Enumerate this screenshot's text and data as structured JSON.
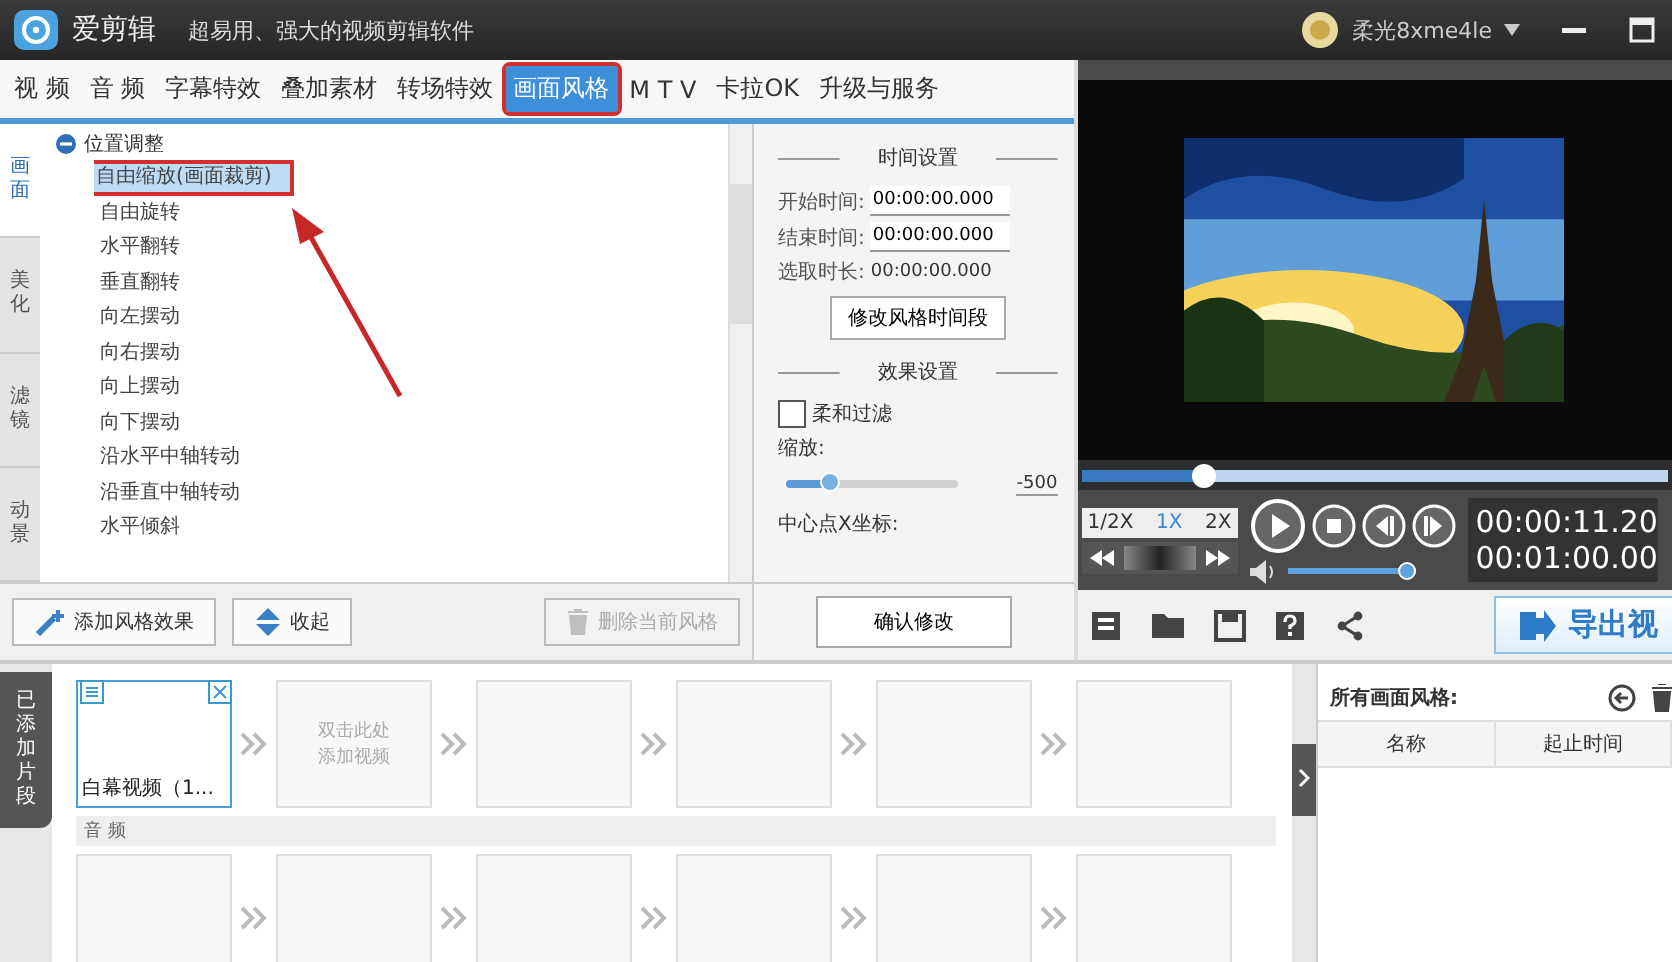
{
  "app": {
    "name": "爱剪辑",
    "slogan": "超易用、强大的视频剪辑软件",
    "user": "柔光8xme4le"
  },
  "tabs": [
    {
      "label": "视 频",
      "selected": false
    },
    {
      "label": "音 频",
      "selected": false
    },
    {
      "label": "字幕特效",
      "selected": false
    },
    {
      "label": "叠加素材",
      "selected": false
    },
    {
      "label": "转场特效",
      "selected": false
    },
    {
      "label": "画面风格",
      "selected": true
    },
    {
      "label": "M T V",
      "selected": false
    },
    {
      "label": "卡拉OK",
      "selected": false
    },
    {
      "label": "升级与服务",
      "selected": false
    }
  ],
  "side_tabs": [
    {
      "label": "画面",
      "selected": true
    },
    {
      "label": "美化",
      "selected": false
    },
    {
      "label": "滤镜",
      "selected": false
    },
    {
      "label": "动景",
      "selected": false
    }
  ],
  "effect_tree": {
    "group": "位置调整",
    "expanded": true,
    "items": [
      {
        "label": "自由缩放(画面裁剪)",
        "selected": true
      },
      {
        "label": "自由旋转",
        "selected": false
      },
      {
        "label": "水平翻转",
        "selected": false
      },
      {
        "label": "垂直翻转",
        "selected": false
      },
      {
        "label": "向左摆动",
        "selected": false
      },
      {
        "label": "向右摆动",
        "selected": false
      },
      {
        "label": "向上摆动",
        "selected": false
      },
      {
        "label": "向下摆动",
        "selected": false
      },
      {
        "label": "沿水平中轴转动",
        "selected": false
      },
      {
        "label": "沿垂直中轴转动",
        "selected": false
      },
      {
        "label": "水平倾斜",
        "selected": false
      }
    ]
  },
  "panel_buttons": [
    {
      "label": "添加风格效果",
      "kind": "add",
      "disabled": false
    },
    {
      "label": "收起",
      "kind": "collapse",
      "disabled": false
    },
    {
      "label": "删除当前风格",
      "kind": "delete",
      "disabled": true
    }
  ],
  "time_settings": {
    "heading": "时间设置",
    "fields": [
      {
        "label": "开始时间:",
        "value": "00:00:00.000",
        "kind": "input"
      },
      {
        "label": "结束时间:",
        "value": "00:00:00.000",
        "kind": "input"
      },
      {
        "label": "选取时长:",
        "value": "00:00:00.000",
        "kind": "text"
      }
    ],
    "button": "修改风格时间段"
  },
  "effect_settings": {
    "heading": "效果设置",
    "soft_filter": {
      "label": "柔和过滤",
      "checked": false
    },
    "zoom": {
      "label": "缩放:",
      "level": 0.25,
      "value": "-500"
    },
    "center_label": "中心点X坐标:"
  },
  "confirm_button": "确认修改",
  "player": {
    "progress": {
      "level": 0.21
    },
    "speeds": [
      {
        "label": "1/2X",
        "selected": false
      },
      {
        "label": "1X",
        "selected": true
      },
      {
        "label": "2X",
        "selected": false
      }
    ],
    "volume": {
      "level": 1.0
    },
    "current_time": "00:00:11.20",
    "total_time": "00:01:00.00",
    "export_button": "导出视"
  },
  "timeline": {
    "tab": "已添加片段",
    "video_clips": [
      {
        "kind": "clip",
        "label": "白幕视频（1...",
        "selected": true
      },
      {
        "kind": "add",
        "label": "双击此处添加视频"
      },
      {
        "kind": "empty"
      },
      {
        "kind": "empty"
      },
      {
        "kind": "empty"
      },
      {
        "kind": "empty"
      }
    ],
    "audio_label": "音 频",
    "audio_clips": [
      {
        "kind": "empty"
      },
      {
        "kind": "empty"
      },
      {
        "kind": "empty"
      },
      {
        "kind": "empty"
      },
      {
        "kind": "empty"
      },
      {
        "kind": "empty"
      }
    ]
  },
  "styles_panel": {
    "title": "所有画面风格:",
    "columns": [
      "名称",
      "起止时间"
    ]
  }
}
